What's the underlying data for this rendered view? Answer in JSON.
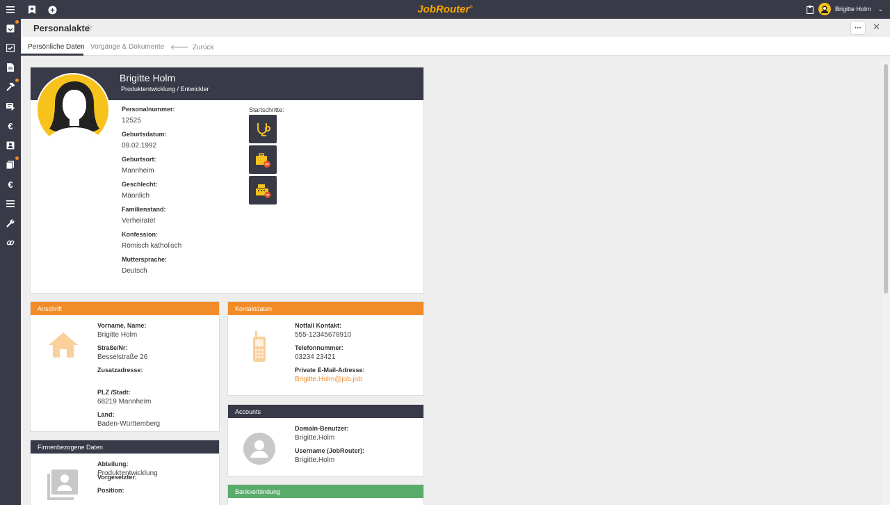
{
  "topbar": {
    "brand": "JobRouter",
    "brand_mark": "®",
    "user_name": "Brigitte Holm"
  },
  "header": {
    "title": "Personalakte",
    "menu_label": "···",
    "close_label": "✕",
    "star_label": "☆"
  },
  "tabs": [
    {
      "label": "Persönliche Daten"
    },
    {
      "label": "Vorgänge & Dokumente"
    },
    {
      "label": "Zurück",
      "icon": "arrow-left-icon"
    }
  ],
  "profile": {
    "name": "Brigitte Holm",
    "role": "Produktentwicklung / Entwickler",
    "fields": [
      {
        "label": "Personalnummer:",
        "value": "12525"
      },
      {
        "label": "Geburtsdatum:",
        "value": "09.02.1992"
      },
      {
        "label": "Geburtsort:",
        "value": "Mannheim"
      },
      {
        "label": "Geschlecht:",
        "value": "Männlich"
      },
      {
        "label": "Familienstand:",
        "value": "Verheiratet"
      },
      {
        "label": "Konfession:",
        "value": "Römisch katholisch"
      },
      {
        "label": "Muttersprache:",
        "value": "Deutsch"
      }
    ],
    "startschritte_label": "Startschritte:",
    "startschritte_icons": [
      "stethoscope-icon",
      "vacation-suitcase-icon",
      "cash-register-icon"
    ]
  },
  "anschrift": {
    "title": "Anschrift",
    "fields": [
      {
        "label": "Vorname, Name:",
        "value": "Brigitte Holm"
      },
      {
        "label": "Straße/Nr:",
        "value": "Besselstraße 26"
      },
      {
        "label": "Zusatzadresse:",
        "value": ""
      },
      {
        "label": "PLZ /Stadt:",
        "value": "68219 Mannheim"
      },
      {
        "label": "Land:",
        "value": "Baden-Württemberg"
      }
    ]
  },
  "kontakt": {
    "title": "Kontaktdaten",
    "fields": [
      {
        "label": "Notfall Kontakt:",
        "value": "555-12345678910"
      },
      {
        "label": "Telefonnummer:",
        "value": "03234 23421"
      },
      {
        "label": "Private E-Mail-Adresse:",
        "value": "Brigitte.Holm@job.job"
      }
    ]
  },
  "accounts": {
    "title": "Accounts",
    "fields": [
      {
        "label": "Domain-Benutzer:",
        "value": "Brigitte.Holm"
      },
      {
        "label": "Username (JobRouter):",
        "value": "Brigitte.Holm"
      }
    ]
  },
  "firma": {
    "title": "Firmenbezogene Daten",
    "fields": [
      {
        "label": "Abteilung:",
        "value": "Produktentwicklung"
      },
      {
        "label": "Vorgesetzter:",
        "value": ""
      },
      {
        "label": "Position:",
        "value": ""
      }
    ]
  },
  "bank": {
    "title": "Bankverbindung"
  },
  "colors": {
    "dark": "#383a48",
    "orange": "#f28c28",
    "green": "#5aac6a",
    "yellow": "#f7c21b"
  }
}
